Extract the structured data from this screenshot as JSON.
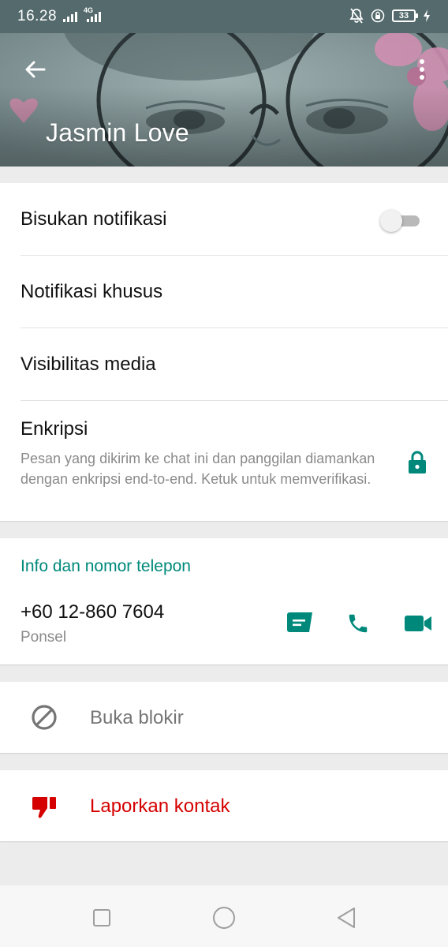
{
  "status_bar": {
    "time": "16.28",
    "network_type": "4G",
    "battery_level": "33",
    "icons": [
      "signal-icon",
      "signal-icon",
      "mute-notification-icon",
      "rotation-lock-icon",
      "battery-icon",
      "charging-icon"
    ]
  },
  "header": {
    "contact_name": "Jasmin Love",
    "back_icon": "arrow-left-icon",
    "menu_icon": "more-vertical-icon"
  },
  "settings": {
    "mute_label": "Bisukan notifikasi",
    "mute_enabled": false,
    "custom_notifications_label": "Notifikasi khusus",
    "media_visibility_label": "Visibilitas media",
    "encryption": {
      "title": "Enkripsi",
      "description": "Pesan yang dikirim ke chat ini dan panggilan diamankan dengan enkripsi end-to-end. Ketuk untuk memverifikasi.",
      "icon": "lock-icon"
    }
  },
  "contact_info": {
    "section_title": "Info dan nomor telepon",
    "phone_number": "+60 12-860 7604",
    "phone_type": "Ponsel",
    "actions": [
      "message-icon",
      "phone-call-icon",
      "video-call-icon"
    ]
  },
  "unblock": {
    "label": "Buka blokir",
    "icon": "block-icon"
  },
  "report": {
    "label": "Laporkan kontak",
    "icon": "thumbs-down-icon"
  },
  "colors": {
    "accent": "#00897b",
    "danger": "#d50000",
    "secondary_text": "#8a8a8a",
    "status_bar": "#546a6c"
  },
  "nav_bar": {
    "icons": [
      "recent-apps-icon",
      "home-icon",
      "back-icon"
    ]
  }
}
